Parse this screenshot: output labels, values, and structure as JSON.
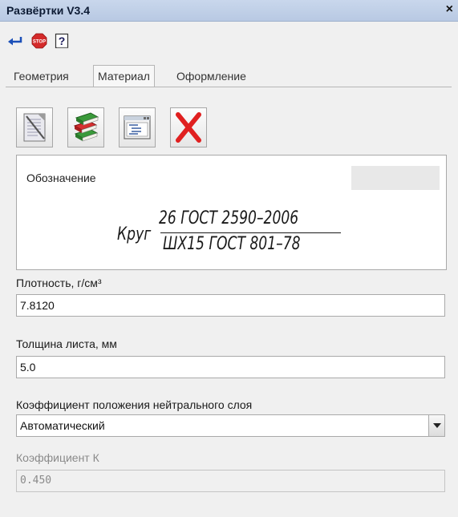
{
  "window": {
    "title": "Развёртки V3.4",
    "close_label": "×"
  },
  "mini_toolbar": {
    "items": [
      {
        "icon": "enter-arrow-icon"
      },
      {
        "icon": "stop-icon",
        "text": "STOP"
      },
      {
        "icon": "help-icon",
        "text": "?"
      }
    ]
  },
  "tabs": [
    {
      "label": "Геометрия",
      "active": false
    },
    {
      "label": "Материал",
      "active": true
    },
    {
      "label": "Оформление",
      "active": false
    }
  ],
  "material_toolbar": {
    "items": [
      {
        "icon": "document-icon"
      },
      {
        "icon": "books-icon"
      },
      {
        "icon": "window-list-icon"
      },
      {
        "icon": "delete-icon"
      }
    ]
  },
  "designation": {
    "label": "Обозначение",
    "prefix": "Круг",
    "numerator": "26 ГОСТ 2590–2006",
    "denominator": "ШХ15 ГОСТ 801–78"
  },
  "fields": {
    "density": {
      "label": "Плотность, г/см³",
      "value": "7.8120"
    },
    "thickness": {
      "label": "Толщина листа, мм",
      "value": "5.0"
    },
    "neutral_layer": {
      "label": "Коэффициент положения нейтрального слоя",
      "value": "Автоматический"
    },
    "k_coefficient": {
      "label": "Коэффициент К",
      "value": "0.450"
    }
  },
  "colors": {
    "title_bar": "#c9d7ec",
    "stop_red": "#d42a2a",
    "delete_red": "#e02020",
    "enter_blue": "#1b4fb8"
  }
}
